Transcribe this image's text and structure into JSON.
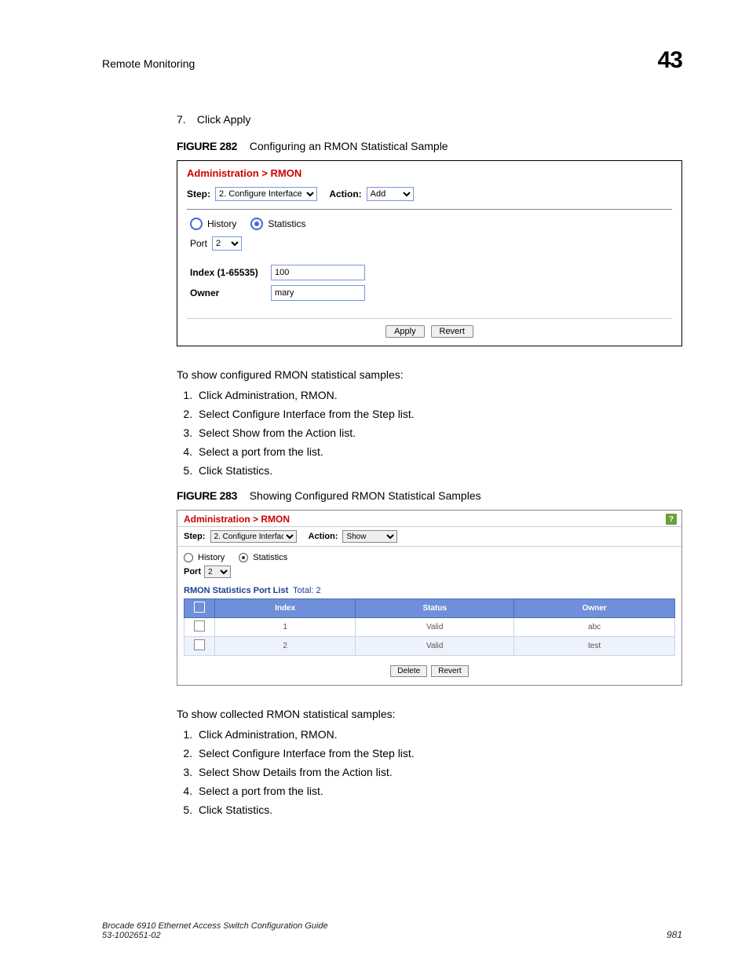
{
  "header": {
    "title": "Remote Monitoring",
    "chapter": "43"
  },
  "step7": {
    "num": "7.",
    "text": "Click Apply"
  },
  "fig282": {
    "label": "FIGURE 282",
    "caption": "Configuring an RMON Statistical Sample",
    "panel_title": "Administration > RMON",
    "step_label": "Step:",
    "step_value": "2. Configure Interface",
    "action_label": "Action:",
    "action_value": "Add",
    "radio_history": "History",
    "radio_statistics": "Statistics",
    "port_label": "Port",
    "port_value": "2",
    "index_label": "Index (1-65535)",
    "index_value": "100",
    "owner_label": "Owner",
    "owner_value": "mary",
    "apply_btn": "Apply",
    "revert_btn": "Revert"
  },
  "para1": "To show configured RMON statistical samples:",
  "steps1": [
    "Click Administration, RMON.",
    "Select Configure Interface from the Step list.",
    "Select Show from the Action list.",
    "Select a port from the list.",
    "Click Statistics."
  ],
  "fig283": {
    "label": "FIGURE 283",
    "caption": "Showing Configured RMON Statistical Samples",
    "panel_title": "Administration > RMON",
    "help_icon": "?",
    "step_label": "Step:",
    "step_value": "2. Configure Interface",
    "action_label": "Action:",
    "action_value": "Show",
    "radio_history": "History",
    "radio_statistics": "Statistics",
    "port_label": "Port",
    "port_value": "2",
    "list_label": "RMON Statistics Port List",
    "total_label": "Total:",
    "total_value": "2",
    "col_index": "Index",
    "col_status": "Status",
    "col_owner": "Owner",
    "rows": [
      {
        "index": "1",
        "status": "Valid",
        "owner": "abc"
      },
      {
        "index": "2",
        "status": "Valid",
        "owner": "test"
      }
    ],
    "delete_btn": "Delete",
    "revert_btn": "Revert"
  },
  "para2": "To show collected RMON statistical samples:",
  "steps2": [
    "Click Administration, RMON.",
    "Select Configure Interface from the Step list.",
    "Select Show Details from the Action list.",
    "Select a port from the list.",
    "Click Statistics."
  ],
  "footer": {
    "line1": "Brocade 6910 Ethernet Access Switch Configuration Guide",
    "line2": "53-1002651-02",
    "page": "981"
  }
}
